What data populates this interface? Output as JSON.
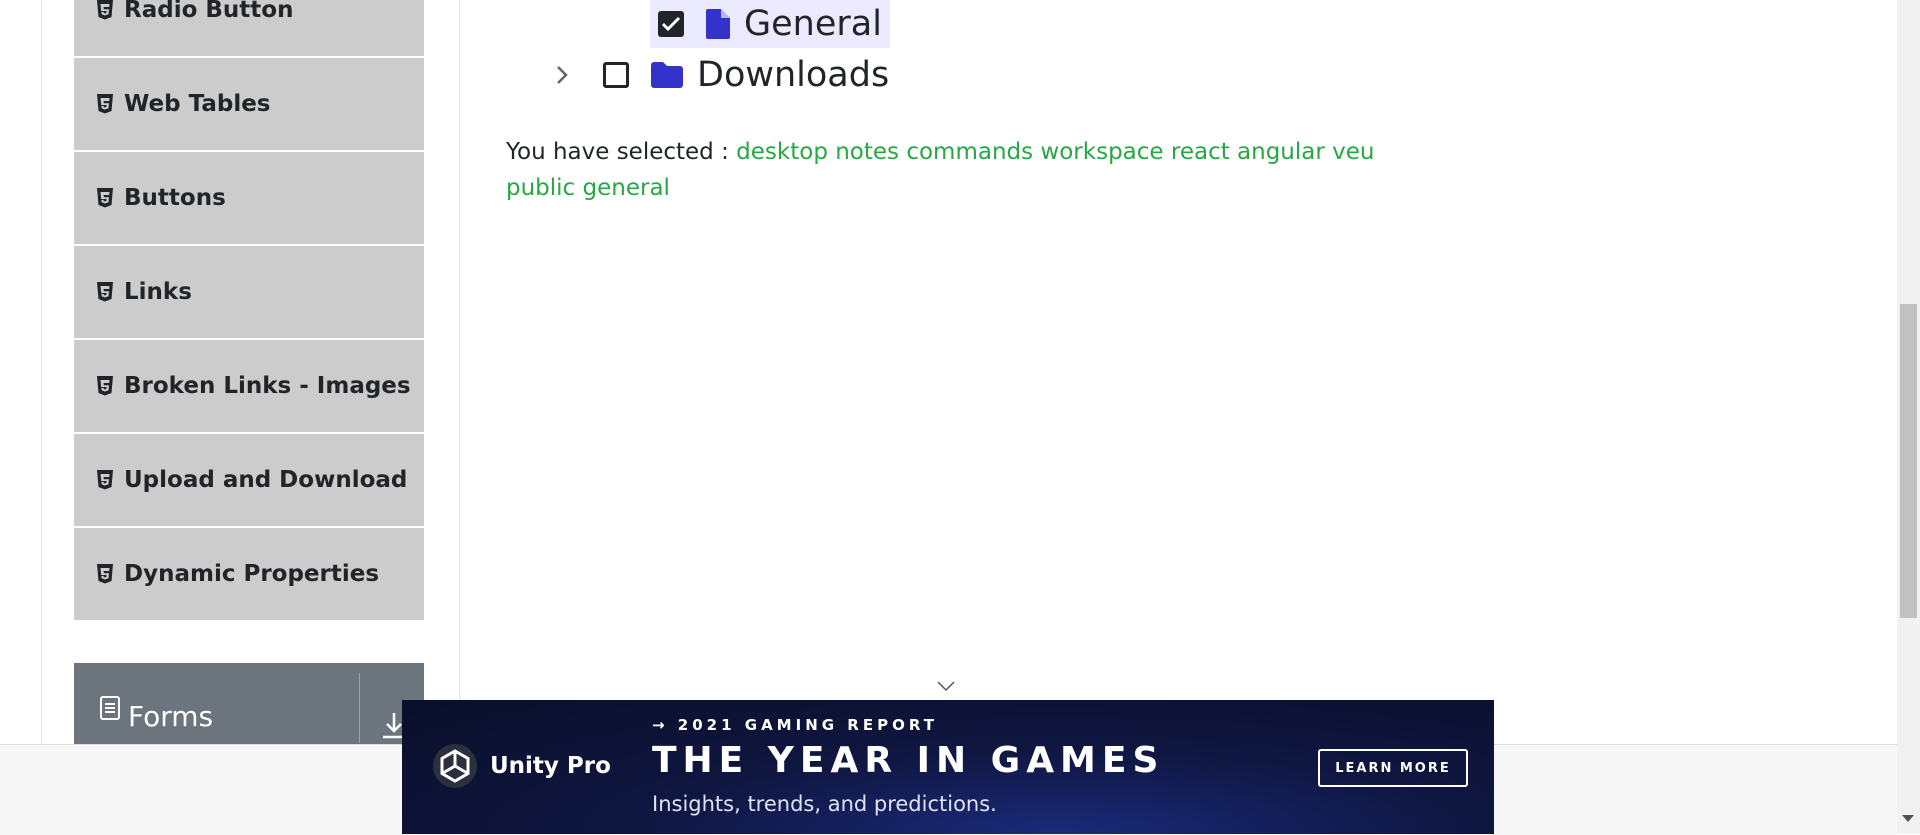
{
  "sidebar": {
    "items": [
      {
        "label": "Radio Button"
      },
      {
        "label": "Web Tables"
      },
      {
        "label": "Buttons"
      },
      {
        "label": "Links"
      },
      {
        "label": "Broken Links - Images"
      },
      {
        "label": "Upload and Download"
      },
      {
        "label": "Dynamic Properties"
      }
    ],
    "group": {
      "label": "Forms"
    }
  },
  "tree": {
    "general": {
      "label": "General",
      "checked": true
    },
    "downloads": {
      "label": "Downloads",
      "checked": false
    }
  },
  "result": {
    "prefix": "You have selected :",
    "selected": "desktop notes commands workspace react angular veu public general"
  },
  "ad": {
    "brand": "Unity Pro",
    "kicker": "→ 2021 GAMING REPORT",
    "headline": "THE YEAR IN GAMES",
    "subtext": "Insights, trends, and predictions.",
    "cta": "LEARN MORE"
  },
  "colors": {
    "sidebar_bg": "#cccccc",
    "group_bg": "#6c757d",
    "selected_text": "#28a745",
    "tree_icon": "#3333cc",
    "highlight": "#eceaff"
  }
}
